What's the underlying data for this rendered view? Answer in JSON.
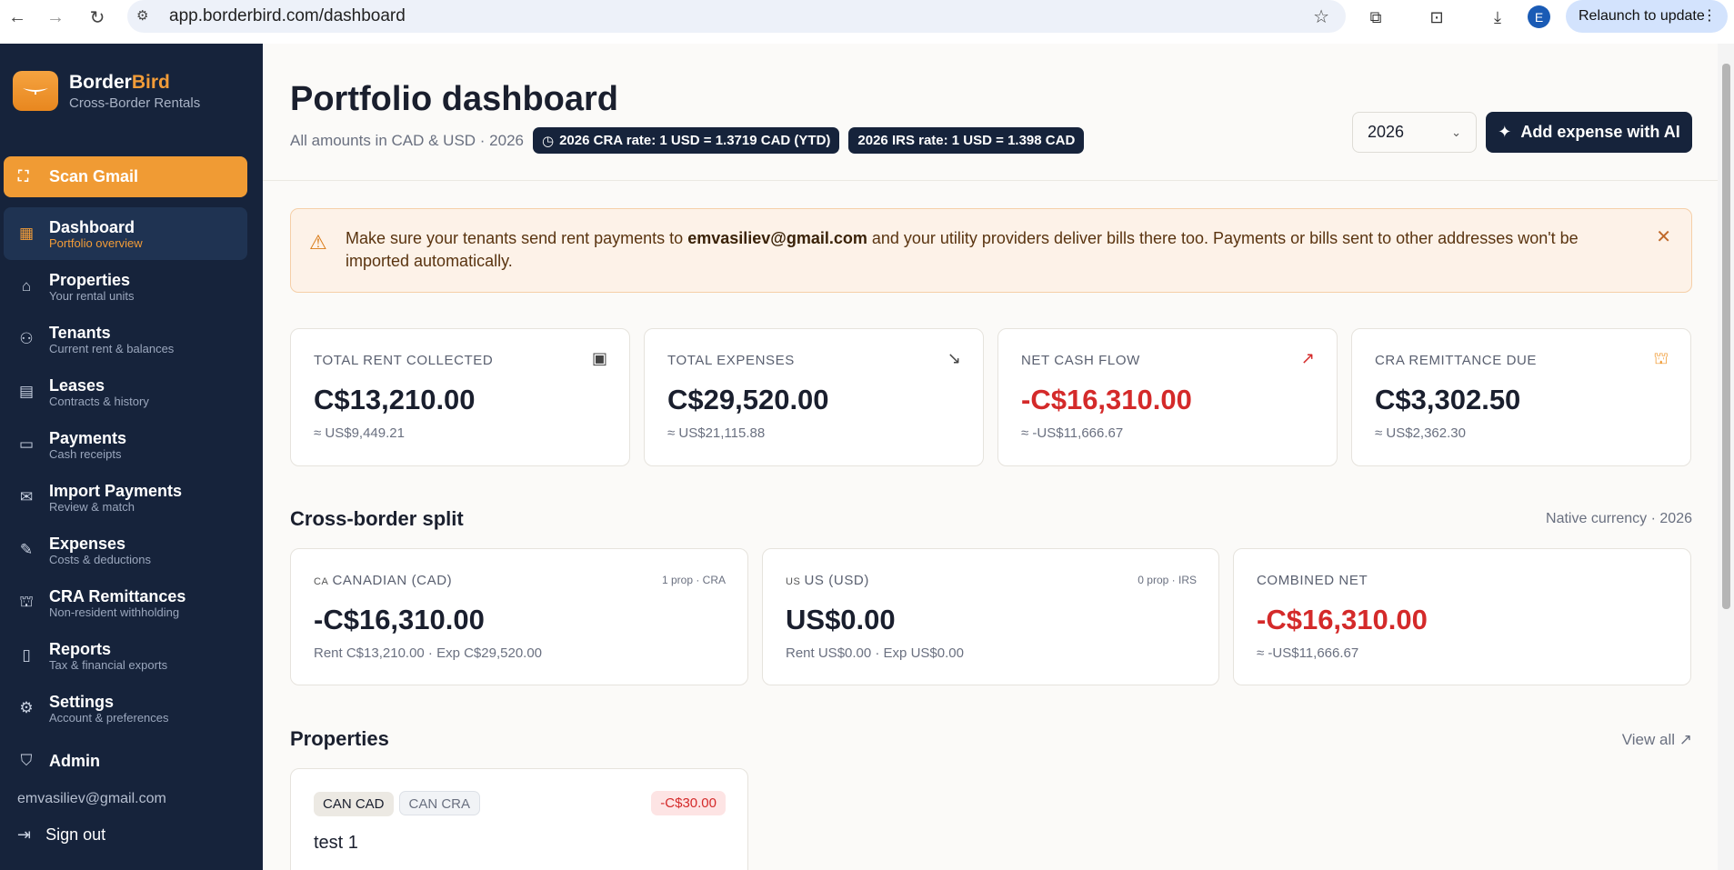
{
  "browser": {
    "url": "app.borderbird.com/dashboard",
    "avatar_letter": "E",
    "relaunch_label": "Relaunch to update"
  },
  "brand": {
    "name_part1": "Border",
    "name_part2": "Bird",
    "tagline": "Cross-Border Rentals"
  },
  "sidebar": {
    "scan_label": "Scan Gmail",
    "items": [
      {
        "label": "Dashboard",
        "sub": "Portfolio overview",
        "icon": "dashboard-icon"
      },
      {
        "label": "Properties",
        "sub": "Your rental units",
        "icon": "home-icon"
      },
      {
        "label": "Tenants",
        "sub": "Current rent & balances",
        "icon": "users-icon"
      },
      {
        "label": "Leases",
        "sub": "Contracts & history",
        "icon": "scroll-icon"
      },
      {
        "label": "Payments",
        "sub": "Cash receipts",
        "icon": "credit-card-icon"
      },
      {
        "label": "Import Payments",
        "sub": "Review & match",
        "icon": "inbox-icon"
      },
      {
        "label": "Expenses",
        "sub": "Costs & deductions",
        "icon": "wrench-icon"
      },
      {
        "label": "CRA Remittances",
        "sub": "Non-resident withholding",
        "icon": "bank-icon"
      },
      {
        "label": "Reports",
        "sub": "Tax & financial exports",
        "icon": "file-icon"
      },
      {
        "label": "Settings",
        "sub": "Account & preferences",
        "icon": "gear-icon"
      },
      {
        "label": "Admin",
        "sub": "",
        "icon": "shield-icon"
      }
    ],
    "email": "emvasiliev@gmail.com",
    "signout_label": "Sign out"
  },
  "header": {
    "title": "Portfolio dashboard",
    "subtitle": "All amounts in CAD & USD · 2026",
    "cra_rate": "2026 CRA rate: 1 USD = 1.3719 CAD (YTD)",
    "irs_rate": "2026 IRS rate: 1 USD = 1.398 CAD",
    "year": "2026",
    "add_expense_label": "Add expense with AI"
  },
  "alert": {
    "text_before": "Make sure your tenants send rent payments to ",
    "email": "emvasiliev@gmail.com",
    "text_after": " and your utility providers deliver bills there too. Payments or bills sent to other addresses won't be imported automatically."
  },
  "stats": [
    {
      "label": "TOTAL RENT COLLECTED",
      "value": "C$13,210.00",
      "sub": "≈ US$9,449.21",
      "icon": "wallet-icon",
      "negative": false
    },
    {
      "label": "TOTAL EXPENSES",
      "value": "C$29,520.00",
      "sub": "≈ US$21,115.88",
      "icon": "trending-down-icon",
      "negative": false
    },
    {
      "label": "NET CASH FLOW",
      "value": "-C$16,310.00",
      "sub": "≈ -US$11,666.67",
      "icon": "trending-up-icon",
      "negative": true
    },
    {
      "label": "CRA REMITTANCE DUE",
      "value": "C$3,302.50",
      "sub": "≈ US$2,362.30",
      "icon": "bank-icon",
      "negative": false
    }
  ],
  "split": {
    "title": "Cross-border split",
    "right": "Native currency · 2026",
    "cards": [
      {
        "flag": "CA",
        "label": "CANADIAN (CAD)",
        "meta": "1 prop · CRA",
        "value": "-C$16,310.00",
        "sub": "Rent C$13,210.00 · Exp C$29,520.00",
        "negative": false
      },
      {
        "flag": "US",
        "label": "US (USD)",
        "meta": "0 prop · IRS",
        "value": "US$0.00",
        "sub": "Rent US$0.00 · Exp US$0.00",
        "negative": false
      },
      {
        "flag": "",
        "label": "COMBINED NET",
        "meta": "",
        "value": "-C$16,310.00",
        "sub": "≈ -US$11,666.67",
        "negative": true
      }
    ]
  },
  "properties": {
    "title": "Properties",
    "view_all": "View all ↗",
    "items": [
      {
        "badge1": "CAN CAD",
        "badge2": "CAN CRA",
        "amount": "-C$30.00",
        "name": "test 1"
      }
    ]
  },
  "colors": {
    "sidebar": "#16233b",
    "accent": "#f09b34",
    "negative": "#d42a2a"
  }
}
